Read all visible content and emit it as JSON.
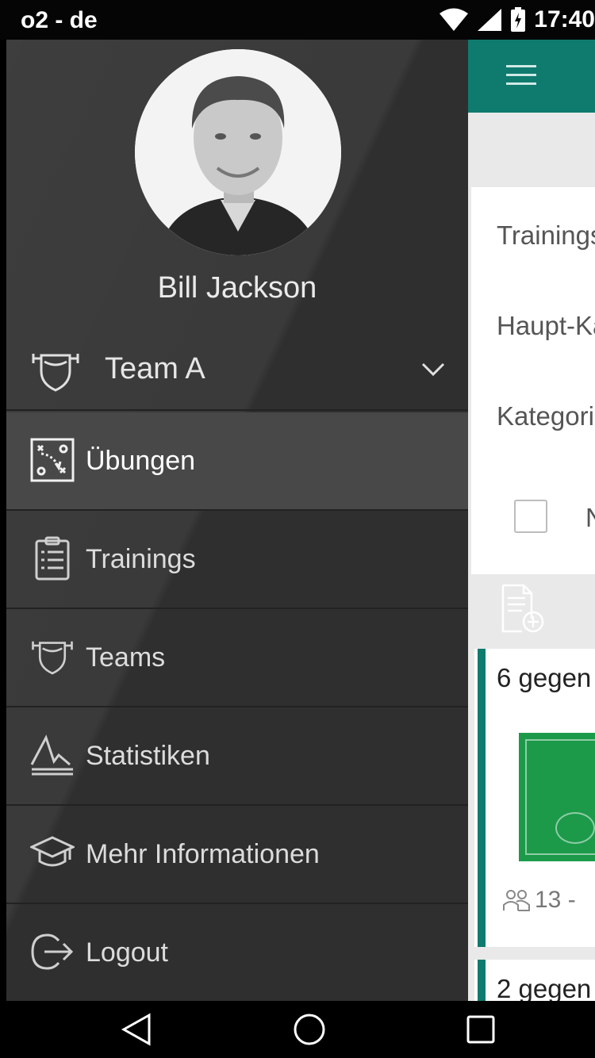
{
  "status_bar": {
    "carrier": "o2 - de",
    "time": "17:40"
  },
  "drawer": {
    "user_name": "Bill Jackson",
    "team": {
      "name": "Team A"
    },
    "items": [
      {
        "label": "Übungen",
        "icon": "tactics-board-icon",
        "active": true
      },
      {
        "label": "Trainings",
        "icon": "clipboard-icon",
        "active": false
      },
      {
        "label": "Teams",
        "icon": "shield-icon",
        "active": false
      },
      {
        "label": "Statistiken",
        "icon": "chart-line-icon",
        "active": false
      },
      {
        "label": "Mehr Informationen",
        "icon": "graduation-cap-icon",
        "active": false
      },
      {
        "label": "Logout",
        "icon": "logout-icon",
        "active": false
      }
    ]
  },
  "content": {
    "filters": [
      "Trainings",
      "Haupt-Ka",
      "Kategori",
      "N"
    ],
    "cards": [
      {
        "title": "6 gegen",
        "meta": "13 -"
      },
      {
        "title": "2 gegen"
      }
    ]
  },
  "colors": {
    "accent": "#0f7a6e",
    "drawer_bg": "#2f2f2f",
    "active_item_bg": "#484848"
  }
}
